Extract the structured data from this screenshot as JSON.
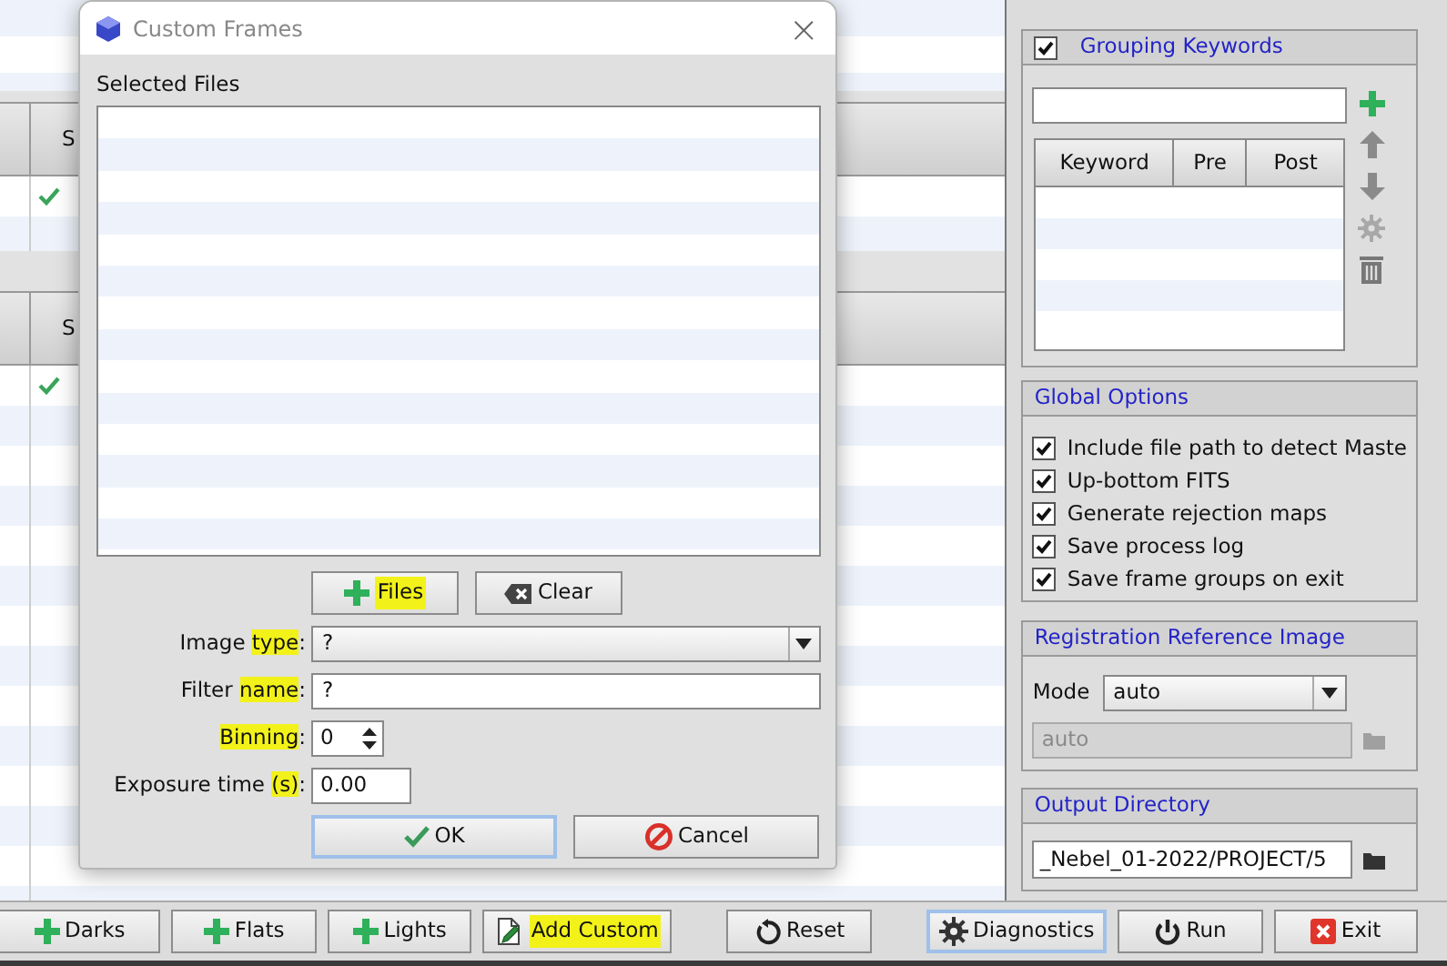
{
  "background": {
    "tables": [
      {
        "header": "S",
        "rows": [
          {
            "checked": true
          }
        ]
      },
      {
        "header": "S",
        "rows": [
          {
            "checked": true
          }
        ]
      }
    ]
  },
  "right_panel": {
    "grouping_keywords": {
      "title": "Grouping Keywords",
      "checked": true,
      "columns": [
        "Keyword",
        "Pre",
        "Post"
      ]
    },
    "global_options": {
      "title": "Global Options",
      "options": [
        {
          "label": "Include file path to detect Maste",
          "checked": true
        },
        {
          "label": "Up-bottom FITS",
          "checked": true
        },
        {
          "label": "Generate rejection maps",
          "checked": true
        },
        {
          "label": "Save process log",
          "checked": true
        },
        {
          "label": "Save frame groups on exit",
          "checked": true
        }
      ]
    },
    "registration_reference_image": {
      "title": "Registration Reference Image",
      "mode_label": "Mode",
      "mode": "auto",
      "file": "auto",
      "file_disabled": true
    },
    "output_directory": {
      "title": "Output Directory",
      "path": "_Nebel_01-2022/PROJECT/5"
    }
  },
  "toolbar": {
    "buttons": [
      {
        "label": "Darks",
        "kind": "plus",
        "highlighted": false,
        "focused": false
      },
      {
        "label": "Flats",
        "kind": "plus",
        "highlighted": false,
        "focused": false
      },
      {
        "label": "Lights",
        "kind": "plus",
        "highlighted": false,
        "focused": false
      },
      {
        "label": "Add Custom",
        "kind": "file-pencil",
        "highlighted": true,
        "focused": false
      },
      {
        "label": "Reset",
        "kind": "reset",
        "highlighted": false,
        "focused": false
      },
      {
        "label": "Diagnostics",
        "kind": "gear",
        "highlighted": false,
        "focused": true
      },
      {
        "label": "Run",
        "kind": "power",
        "highlighted": false,
        "focused": false
      },
      {
        "label": "Exit",
        "kind": "exit",
        "highlighted": false,
        "focused": false
      }
    ]
  },
  "dialog": {
    "title": "Custom Frames",
    "close": "×",
    "files_label": "Selected Files",
    "list_buttons": [
      {
        "label": "Files",
        "kind": "plus",
        "highlighted": true,
        "focused": false
      },
      {
        "label": "Clear",
        "kind": "eraser",
        "highlighted": false,
        "focused": false
      }
    ],
    "fields": [
      {
        "kind": "select",
        "label": [
          {
            "text": "Image ",
            "highlighted": false
          },
          {
            "text": "type",
            "highlighted": true
          },
          {
            "text": ":",
            "highlighted": false
          }
        ],
        "value": "?"
      },
      {
        "kind": "text",
        "label": [
          {
            "text": "Filter ",
            "highlighted": false
          },
          {
            "text": "name",
            "highlighted": true
          },
          {
            "text": ":",
            "highlighted": false
          }
        ],
        "value": "?"
      },
      {
        "kind": "spin",
        "label": [
          {
            "text": "Binning",
            "highlighted": true
          },
          {
            "text": ":",
            "highlighted": false
          }
        ],
        "value": "0"
      },
      {
        "kind": "number",
        "label": [
          {
            "text": "Exposure time ",
            "highlighted": false
          },
          {
            "text": "(s)",
            "highlighted": true
          },
          {
            "text": ":",
            "highlighted": false
          }
        ],
        "value": "0.00"
      }
    ],
    "buttons": [
      {
        "label": "OK",
        "kind": "check",
        "highlighted": false,
        "focused": true
      },
      {
        "label": "Cancel",
        "kind": "cancel",
        "highlighted": false,
        "focused": false
      }
    ]
  }
}
